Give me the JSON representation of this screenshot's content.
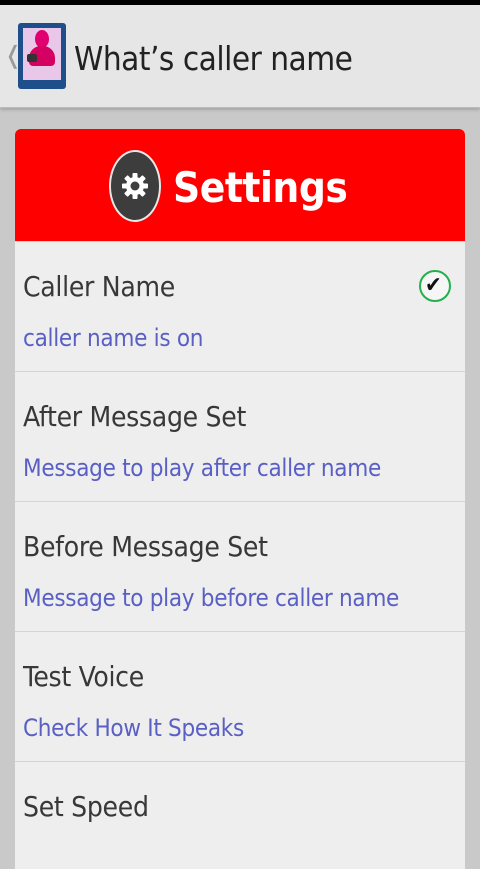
{
  "actionbar": {
    "up_glyph": "❬",
    "title": "What’s caller name",
    "app_icon": "caller-avatar-icon"
  },
  "header": {
    "title": "Settings",
    "icon": "gear-icon"
  },
  "settings": [
    {
      "title": "Caller Name",
      "summary": "caller name is on",
      "checked": true
    },
    {
      "title": "After Message Set",
      "summary": "Message to play after caller name"
    },
    {
      "title": "Before Message Set",
      "summary": "Message to play before caller name"
    },
    {
      "title": "Test Voice",
      "summary": "Check How It Speaks"
    },
    {
      "title": "Set Speed",
      "summary": ""
    }
  ],
  "check_glyph": "✔",
  "colors": {
    "header": "#ff0000",
    "summary": "#5a5fc4",
    "check_ring": "#22b04c"
  }
}
